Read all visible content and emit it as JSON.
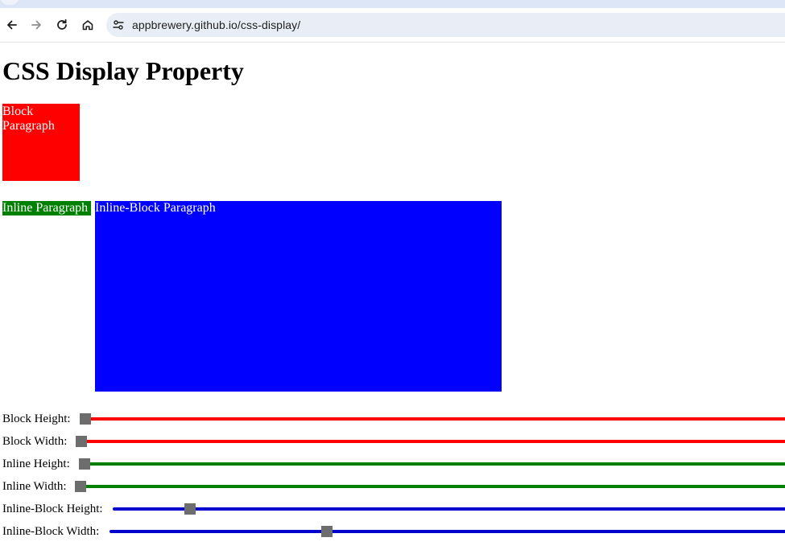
{
  "browser": {
    "url": "appbrewery.github.io/css-display/",
    "icons": [
      "back-arrow-icon",
      "forward-arrow-icon",
      "reload-icon",
      "home-icon",
      "site-info-icon"
    ]
  },
  "page": {
    "title": "CSS Display Property",
    "block_paragraph": "Block Paragraph",
    "inline_paragraph": "Inline Paragraph",
    "inline_block_paragraph": "Inline-Block Paragraph"
  },
  "colors": {
    "block": "#ff0000",
    "inline": "#008000",
    "inline_block": "#0000ff",
    "thumb": "#6d6d6d"
  },
  "sliders": [
    {
      "id": "block-height",
      "label": "Block Height:",
      "color": "red",
      "value_fraction": 0.0
    },
    {
      "id": "block-width",
      "label": "Block Width:",
      "color": "red",
      "value_fraction": 0.0
    },
    {
      "id": "inline-height",
      "label": "Inline Height:",
      "color": "green",
      "value_fraction": 0.0
    },
    {
      "id": "inline-width",
      "label": "Inline Width:",
      "color": "green",
      "value_fraction": 0.0
    },
    {
      "id": "inline-block-height",
      "label": "Inline-Block Height:",
      "color": "blue",
      "value_fraction": 0.11
    },
    {
      "id": "inline-block-width",
      "label": "Inline-Block Width:",
      "color": "blue",
      "value_fraction": 0.32
    }
  ]
}
